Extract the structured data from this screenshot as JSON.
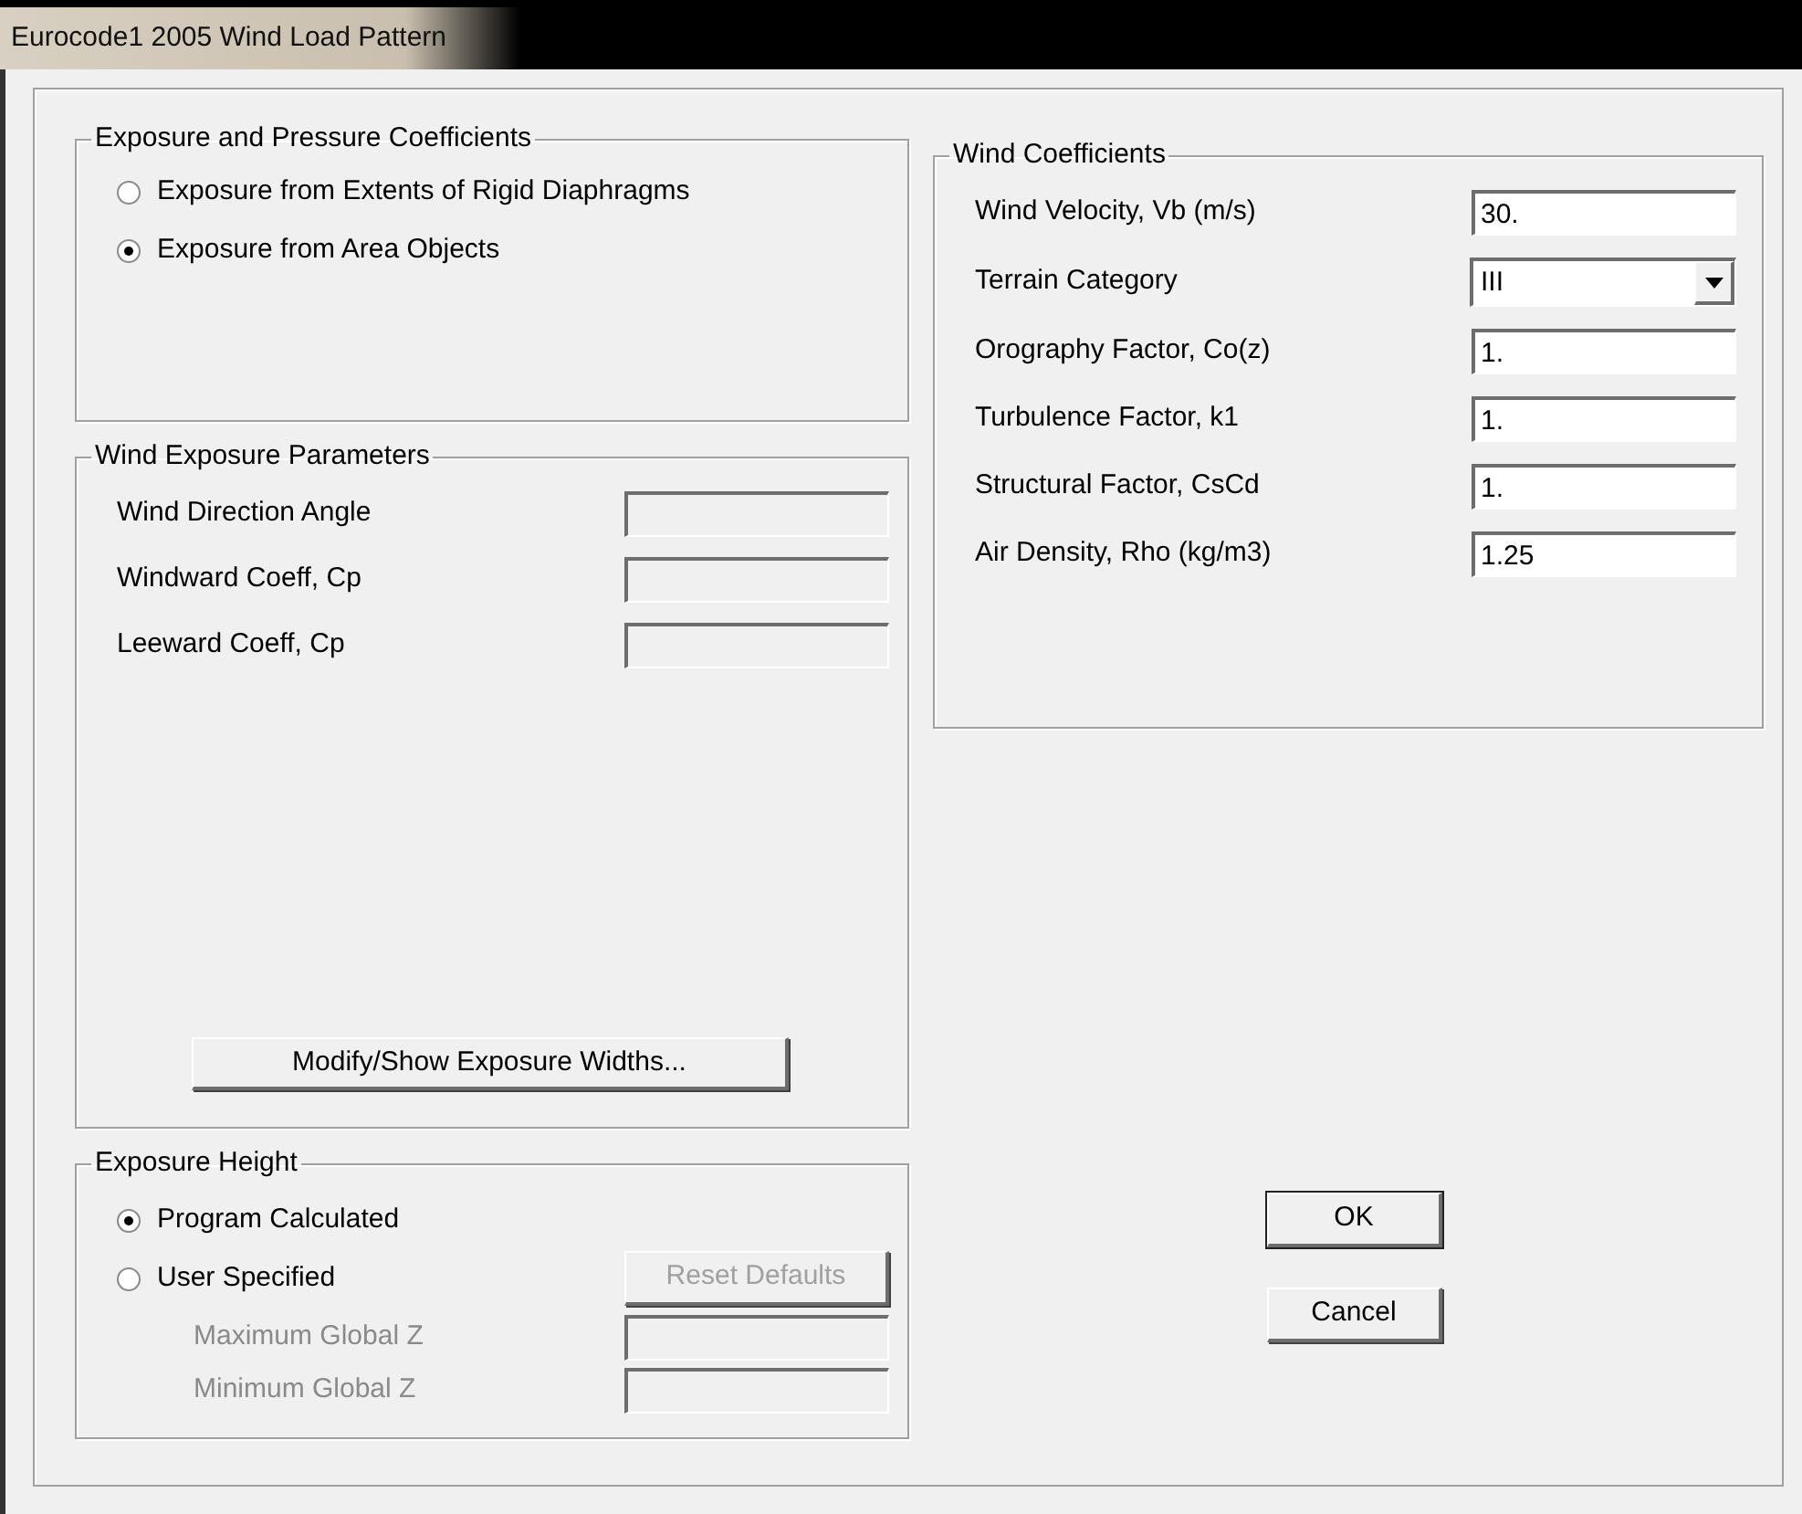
{
  "window": {
    "title": "Eurocode1 2005 Wind Load Pattern"
  },
  "exposure_pressure": {
    "title": "Exposure and Pressure Coefficients",
    "options": [
      {
        "label": "Exposure from Extents of Rigid Diaphragms",
        "selected": false
      },
      {
        "label": "Exposure from Area Objects",
        "selected": true
      }
    ]
  },
  "wind_exposure": {
    "title": "Wind Exposure Parameters",
    "fields": [
      {
        "label": "Wind Direction Angle",
        "disabled": true
      },
      {
        "label": "Windward Coeff, Cp",
        "disabled": true
      },
      {
        "label": "Leeward Coeff, Cp",
        "disabled": true
      }
    ],
    "button": {
      "label": "Modify/Show Exposure Widths...",
      "disabled": false
    }
  },
  "exposure_height": {
    "title": "Exposure Height",
    "options": [
      {
        "label": "Program Calculated",
        "selected": true
      },
      {
        "label": "User Specified",
        "selected": false
      }
    ],
    "reset_button": {
      "label": "Reset Defaults",
      "disabled": true
    },
    "fields": [
      {
        "label": "Maximum Global Z",
        "disabled": true
      },
      {
        "label": "Minimum Global Z",
        "disabled": true
      }
    ]
  },
  "wind_coefficients": {
    "title": "Wind Coefficients",
    "fields": [
      {
        "kind": "text",
        "label": "Wind Velocity, Vb (m/s)",
        "value": "30."
      },
      {
        "kind": "dropdown",
        "label": "Terrain Category",
        "value": "III"
      },
      {
        "kind": "text",
        "label": "Orography Factor, Co(z)",
        "value": "1."
      },
      {
        "kind": "text",
        "label": "Turbulence Factor, k1",
        "value": "1."
      },
      {
        "kind": "text",
        "label": "Structural Factor, CsCd",
        "value": "1."
      },
      {
        "kind": "text",
        "label": "Air Density, Rho (kg/m3)",
        "value": "1.25"
      }
    ]
  },
  "buttons": [
    {
      "label": "OK",
      "default": true
    },
    {
      "label": "Cancel",
      "default": false
    }
  ]
}
